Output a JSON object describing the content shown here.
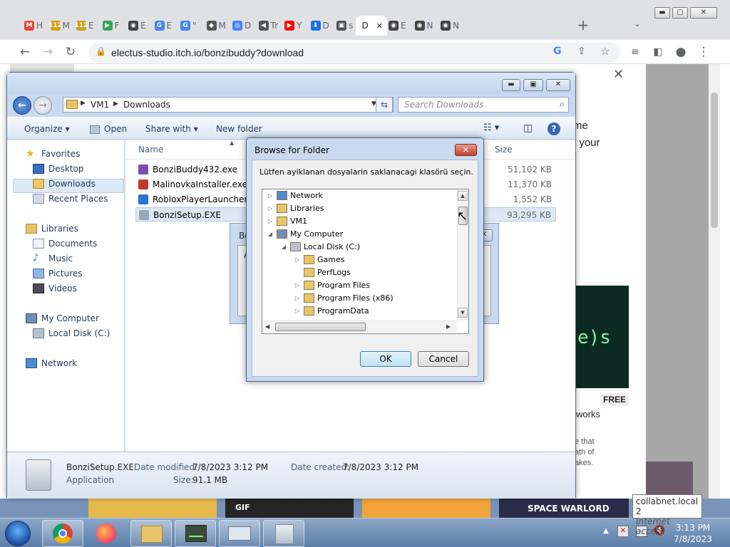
{
  "browser": {
    "tabs": [
      {
        "label": "H",
        "fav": "M"
      },
      {
        "label": "M",
        "fav": "112"
      },
      {
        "label": "E",
        "fav": "112"
      },
      {
        "label": "F",
        "fav": "▶"
      },
      {
        "label": "E",
        "fav": "◉"
      },
      {
        "label": "E",
        "fav": "G"
      },
      {
        "label": "\"",
        "fav": "G"
      },
      {
        "label": "M",
        "fav": "◆"
      },
      {
        "label": "D",
        "fav": "◎"
      },
      {
        "label": "Tr",
        "fav": "◀"
      },
      {
        "label": "Y",
        "fav": "▶"
      },
      {
        "label": "D",
        "fav": "⬇"
      },
      {
        "label": "s",
        "fav": "▣"
      },
      {
        "label": "D",
        "fav": ""
      },
      {
        "label": "E",
        "fav": "◉"
      },
      {
        "label": "N",
        "fav": "◉"
      },
      {
        "label": "N",
        "fav": "◉"
      }
    ],
    "active_tab_label": "D",
    "url": "electus-studio.itch.io/bonzibuddy?download",
    "new_tab": "+",
    "tab_search": "⌄"
  },
  "webpage": {
    "close": "✕",
    "snippet1": "me",
    "snippet2": "t your",
    "free_badge": "FREE",
    "works": "works",
    "small1": "e that",
    "small2": "ath of",
    "small3": "akes.",
    "gif": "GIF",
    "space": "SPACE WARLORD"
  },
  "explorer": {
    "path": [
      "VM1",
      "Downloads"
    ],
    "search_placeholder": "Search Downloads",
    "commands": {
      "organize": "Organize",
      "open": "Open",
      "share": "Share with",
      "newfolder": "New folder"
    },
    "nav": {
      "favorites": "Favorites",
      "desktop": "Desktop",
      "downloads": "Downloads",
      "recent": "Recent Places",
      "libraries": "Libraries",
      "documents": "Documents",
      "music": "Music",
      "pictures": "Pictures",
      "videos": "Videos",
      "computer": "My Computer",
      "localdisk": "Local Disk (C:)",
      "network": "Network"
    },
    "columns": {
      "name": "Name",
      "size": "Size"
    },
    "files": [
      {
        "name": "BonziBuddy432.exe",
        "size": "51,102 KB"
      },
      {
        "name": "MalinovkaInstaller.exe",
        "size": "11,370 KB"
      },
      {
        "name": "RobloxPlayerLauncher.exe",
        "size": "1,552 KB"
      },
      {
        "name": "BonziSetup.EXE",
        "size": "93,295 KB"
      }
    ],
    "details": {
      "name": "BonziSetup.EXE",
      "type": "Application",
      "modified_label": "Date modified:",
      "modified": "7/8/2023 3:12 PM",
      "created_label": "Date created:",
      "created": "7/8/2023 3:12 PM",
      "size_label": "Size:",
      "size": "91.1 MB"
    }
  },
  "bgdialog": {
    "title_fragment": "Bo",
    "letter": "A"
  },
  "browse": {
    "title": "Browse for Folder",
    "message": "Lütfen ayiklanan dosyalarin saklanacagi klasörü seçin.",
    "tree": [
      {
        "label": "Network",
        "level": 0,
        "exp": "▷"
      },
      {
        "label": "Libraries",
        "level": 0,
        "exp": "▷"
      },
      {
        "label": "VM1",
        "level": 0,
        "exp": "▷"
      },
      {
        "label": "My Computer",
        "level": 0,
        "exp": "◢"
      },
      {
        "label": "Local Disk (C:)",
        "level": 1,
        "exp": "◢"
      },
      {
        "label": "Games",
        "level": 2,
        "exp": "▷"
      },
      {
        "label": "PerfLogs",
        "level": 2,
        "exp": ""
      },
      {
        "label": "Program Files",
        "level": 2,
        "exp": "▷"
      },
      {
        "label": "Program Files (x86)",
        "level": 2,
        "exp": "▷"
      },
      {
        "label": "ProgramData",
        "level": 2,
        "exp": "▷"
      }
    ],
    "ok": "OK",
    "cancel": "Cancel"
  },
  "taskbar": {
    "time": "3:13 PM",
    "date": "7/8/2023",
    "tooltip_line1": "collabnet.local  2",
    "tooltip_line2": "Internet access"
  }
}
